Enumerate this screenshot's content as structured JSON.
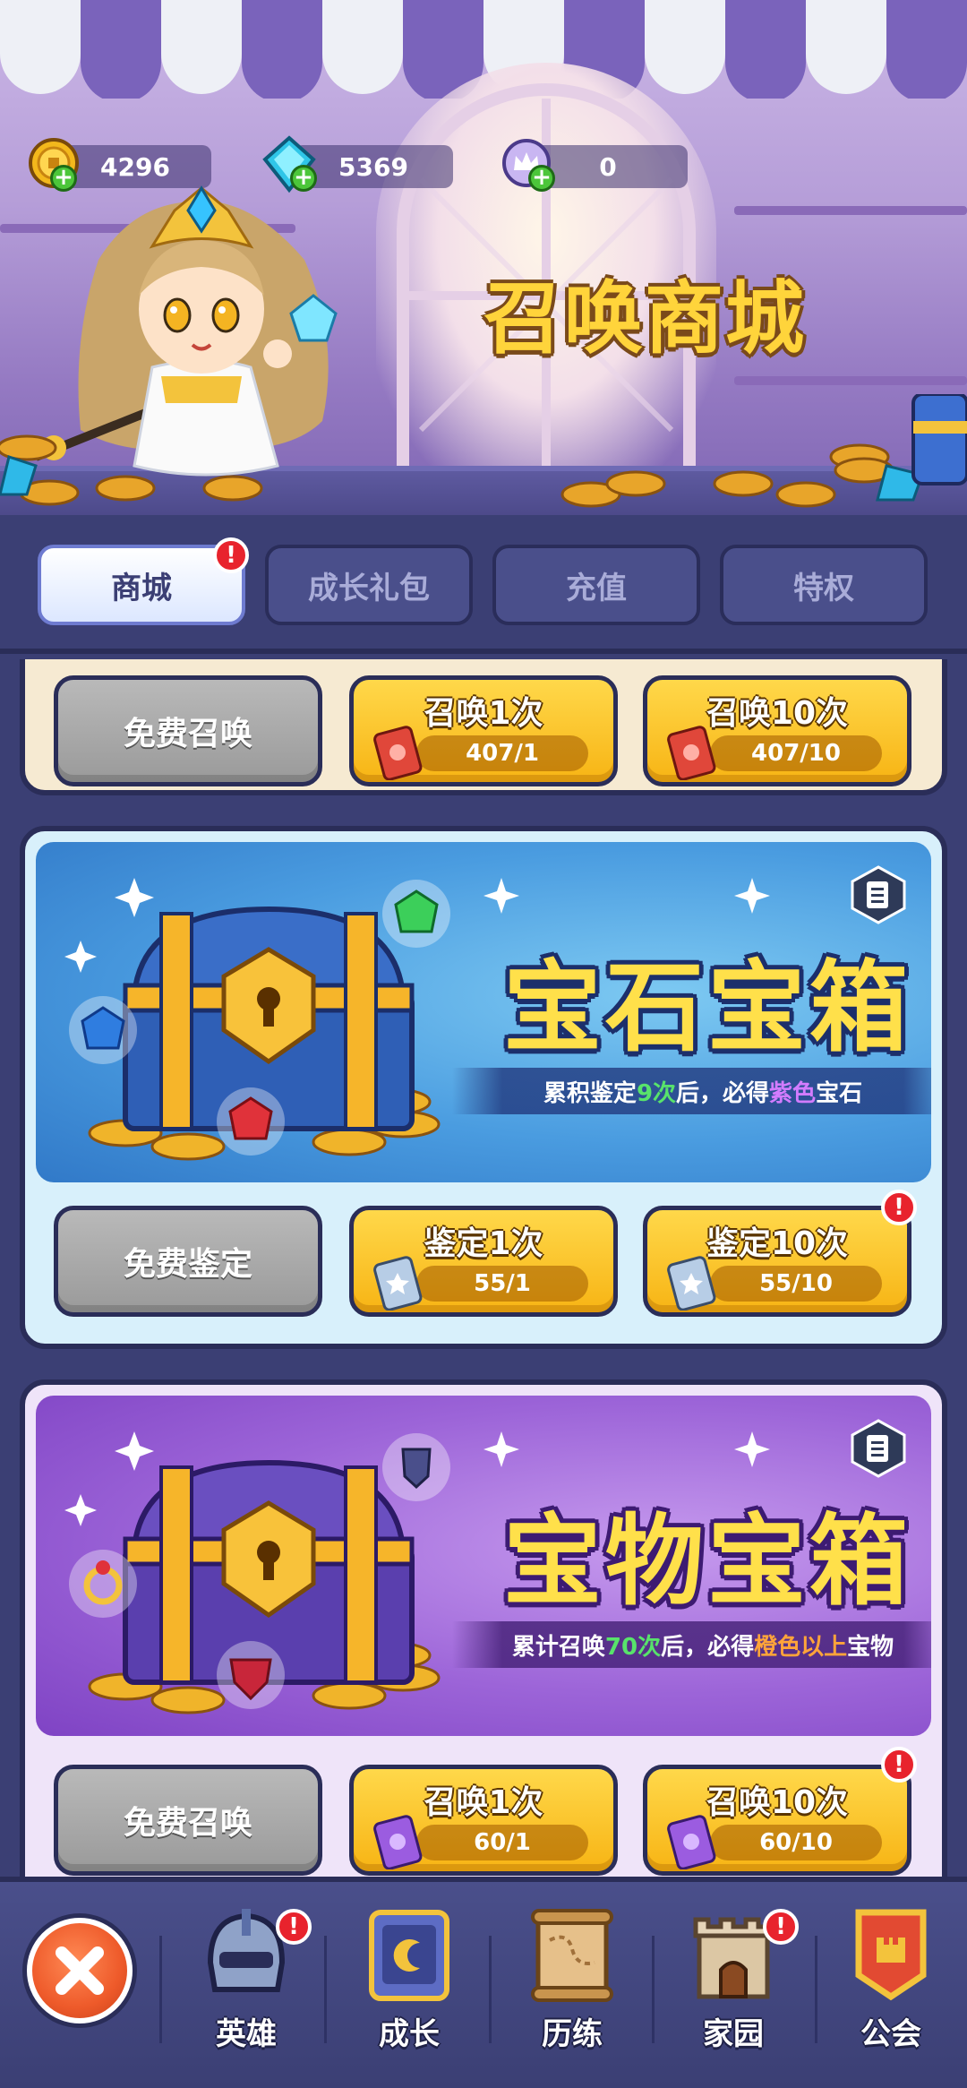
{
  "header": {
    "title": "召唤商城",
    "currencies": [
      {
        "icon": "gold-coin-icon",
        "value": "4296"
      },
      {
        "icon": "diamond-icon",
        "value": "5369"
      },
      {
        "icon": "crown-token-icon",
        "value": "0"
      }
    ]
  },
  "tabs": [
    {
      "label": "商城",
      "active": true,
      "badge": "!"
    },
    {
      "label": "成长礼包",
      "active": false
    },
    {
      "label": "充值",
      "active": false
    },
    {
      "label": "特权",
      "active": false
    }
  ],
  "cards": {
    "top": {
      "free_label": "免费召唤",
      "buttons": [
        {
          "label": "召唤1次",
          "count": "407/1"
        },
        {
          "label": "召唤10次",
          "count": "407/10"
        }
      ]
    },
    "gem": {
      "title": "宝石宝箱",
      "hint_pre": "累积鉴定",
      "hint_num": "9次",
      "hint_mid": "后，必得",
      "hint_hl": "紫色",
      "hint_post": "宝石",
      "free_label": "免费鉴定",
      "buttons": [
        {
          "label": "鉴定1次",
          "count": "55/1"
        },
        {
          "label": "鉴定10次",
          "count": "55/10",
          "badge": "!"
        }
      ]
    },
    "treasure": {
      "title": "宝物宝箱",
      "hint_pre": "累计召唤",
      "hint_num": "70次",
      "hint_mid": "后，必得",
      "hint_hl": "橙色以上",
      "hint_post": "宝物",
      "free_label": "免费召唤",
      "buttons": [
        {
          "label": "召唤1次",
          "count": "60/1"
        },
        {
          "label": "召唤10次",
          "count": "60/10",
          "badge": "!"
        }
      ]
    }
  },
  "bottom_nav": [
    {
      "label": "英雄",
      "icon": "hero-helmet-icon",
      "badge": "!"
    },
    {
      "label": "成长",
      "icon": "growth-scroll-icon"
    },
    {
      "label": "历练",
      "icon": "map-scroll-icon"
    },
    {
      "label": "家园",
      "icon": "castle-icon",
      "badge": "!"
    },
    {
      "label": "公会",
      "icon": "guild-banner-icon"
    }
  ],
  "colors": {
    "background": "#3b3f74",
    "gold": "#f7b414",
    "title_yellow": "#ffe04a",
    "badge_red": "#e8232d"
  }
}
